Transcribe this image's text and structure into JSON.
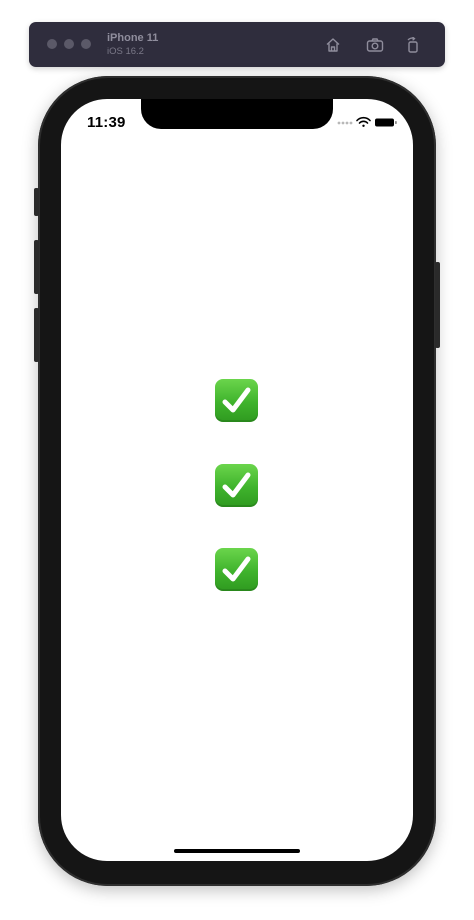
{
  "simulator": {
    "device_name": "iPhone 11",
    "os_version": "iOS 16.2",
    "toolbar": {
      "home_icon": "home-icon",
      "screenshot_icon": "camera-icon",
      "rotate_icon": "rotate-icon"
    }
  },
  "status_bar": {
    "time": "11:39",
    "icons": [
      "cellular-dots-icon",
      "wifi-icon",
      "battery-icon"
    ]
  },
  "content": {
    "items": [
      {
        "icon": "check-mark-button-icon",
        "color": "#3fb32c"
      },
      {
        "icon": "check-mark-button-icon",
        "color": "#3fb32c"
      },
      {
        "icon": "check-mark-button-icon",
        "color": "#3fb32c"
      }
    ]
  },
  "colors": {
    "device_frame": "#151515",
    "simulator_bar": "#2f2d3d",
    "check_green": "#3fb32c"
  }
}
